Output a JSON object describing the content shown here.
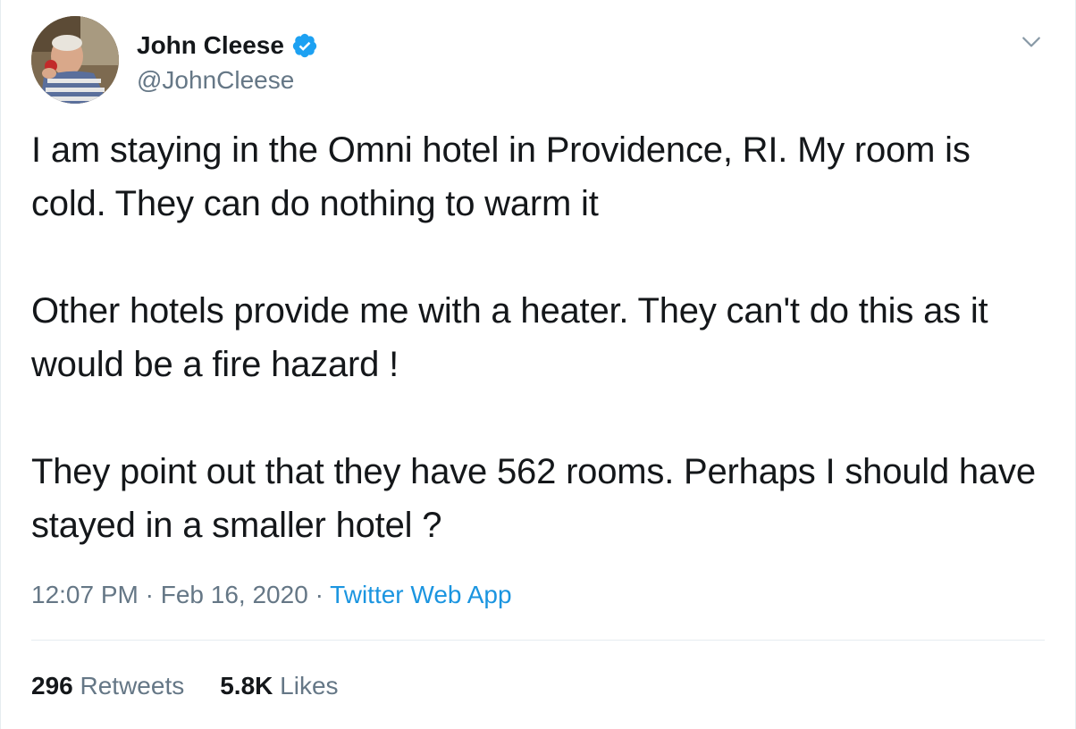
{
  "author": {
    "display_name": "John Cleese",
    "handle": "@JohnCleese",
    "verified": true,
    "avatar_icon": "profile-photo"
  },
  "tweet": {
    "paragraphs": [
      "I am staying in the Omni hotel in Providence, RI. My room is cold. They can do nothing to warm it",
      "Other hotels provide me with a heater. They can't do this as it would be a fire hazard !",
      "They point out that they have 562 rooms. Perhaps I should have stayed in a smaller hotel ?"
    ],
    "time": "12:07 PM",
    "date": "Feb 16, 2020",
    "separator": "·",
    "source": "Twitter Web App"
  },
  "stats": {
    "retweets_count": "296",
    "retweets_label": "Retweets",
    "likes_count": "5.8K",
    "likes_label": "Likes"
  },
  "colors": {
    "text_primary": "#14171a",
    "text_secondary": "#657786",
    "link": "#1b95e0",
    "verified_badge": "#1da1f2",
    "divider": "#e6ecf0"
  }
}
